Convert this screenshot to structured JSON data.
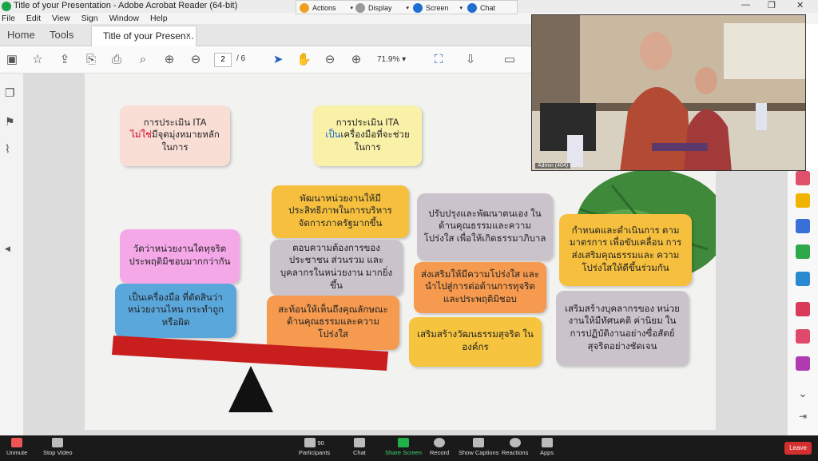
{
  "window": {
    "title": "Title of your Presentation - Adobe Acrobat Reader (64-bit)",
    "menu": [
      "File",
      "Edit",
      "View",
      "Sign",
      "Window",
      "Help"
    ]
  },
  "share_toolbar": {
    "items": [
      {
        "label": "Actions",
        "icon": "lightning-icon"
      },
      {
        "label": "Display",
        "icon": "gear-icon"
      },
      {
        "label": "Screen",
        "icon": "screen-icon"
      },
      {
        "label": "Chat",
        "icon": "chat-icon"
      }
    ]
  },
  "tabs": {
    "home": "Home",
    "tools": "Tools",
    "document": "Title of your Presen...",
    "close": "×"
  },
  "toolbar": {
    "page_current": "2",
    "page_total": "/ 6",
    "zoom": "71.9%"
  },
  "slide": {
    "box1_line1": "การประเมิน ITA",
    "box1_red": "ไม่ใช่",
    "box1_line2": "มีจุดมุ่งหมายหลัก",
    "box1_line3": "ในการ",
    "box2_line1": "การประเมิน ITA",
    "box2_blue": "เป็น",
    "box2_line2": "เครื่องมือที่จะช่วย",
    "box2_line3": "ในการ",
    "pink": "วัดว่าหน่วยงานใดทุจริต ประพฤติมิชอบมากกว่ากัน",
    "blue": "เป็นเครื่องมือ ที่ตัดสินว่าหน่วยงานไหน กระทำถูกหรือผิด",
    "y1": "พัฒนาหน่วยงานให้มี ประสิทธิภาพในการบริหาร จัดการภาครัฐมากขึ้น",
    "g1": "ตอบความต้องการของ ประชาชน ส่วนรวม และ บุคลากรในหน่วยงาน มากยิ่งขึ้น",
    "o1": "สะท้อนให้เห็นถึงคุณลักษณะ ด้านคุณธรรมและความโปร่งใส",
    "g2": "ปรับปรุงและพัฒนาตนเอง ในด้านคุณธรรมและความ โปร่งใส เพื่อให้เกิดธรรมาภิบาล",
    "o2": "ส่งเสริมให้มีความโปร่งใส และ นำไปสู่การต่อต้านการทุจริต และประพฤติมิชอบ",
    "y2": "เสริมสร้างวัฒนธรรมสุจริต ในองค์กร",
    "y3": "กำหนดและดำเนินการ ตามมาตรการ เพื่อขับเคลื่อน การส่งเสริมคุณธรรมและ ความโปร่งใสให้ดีขึ้นร่วมกัน",
    "g3": "เสริมสร้างบุคลากรของ หน่วยงานให้มีทัศนคติ ค่านิยม ในการปฏิบัติงานอย่างซื่อสัตย์ สุจริตอย่างชัดเจน"
  },
  "video": {
    "label": "Admin (404)"
  },
  "meeting_bar": {
    "unmute": "Unmute",
    "stop_video": "Stop Video",
    "participants_count": "90",
    "participants": "Participants",
    "chat": "Chat",
    "share": "Share Screen",
    "record": "Record",
    "captions": "Show Captions",
    "reactions": "Reactions",
    "apps": "Apps",
    "leave": "Leave"
  },
  "colors": {
    "pink_box": "#f5a8c8",
    "blue_box": "#5aa7dc",
    "yellow_box": "#f6c44a",
    "gray_box": "#cbc3cc",
    "orange_box": "#f5a05a",
    "beam": "#c81e1e",
    "fulcrum": "#111111"
  }
}
